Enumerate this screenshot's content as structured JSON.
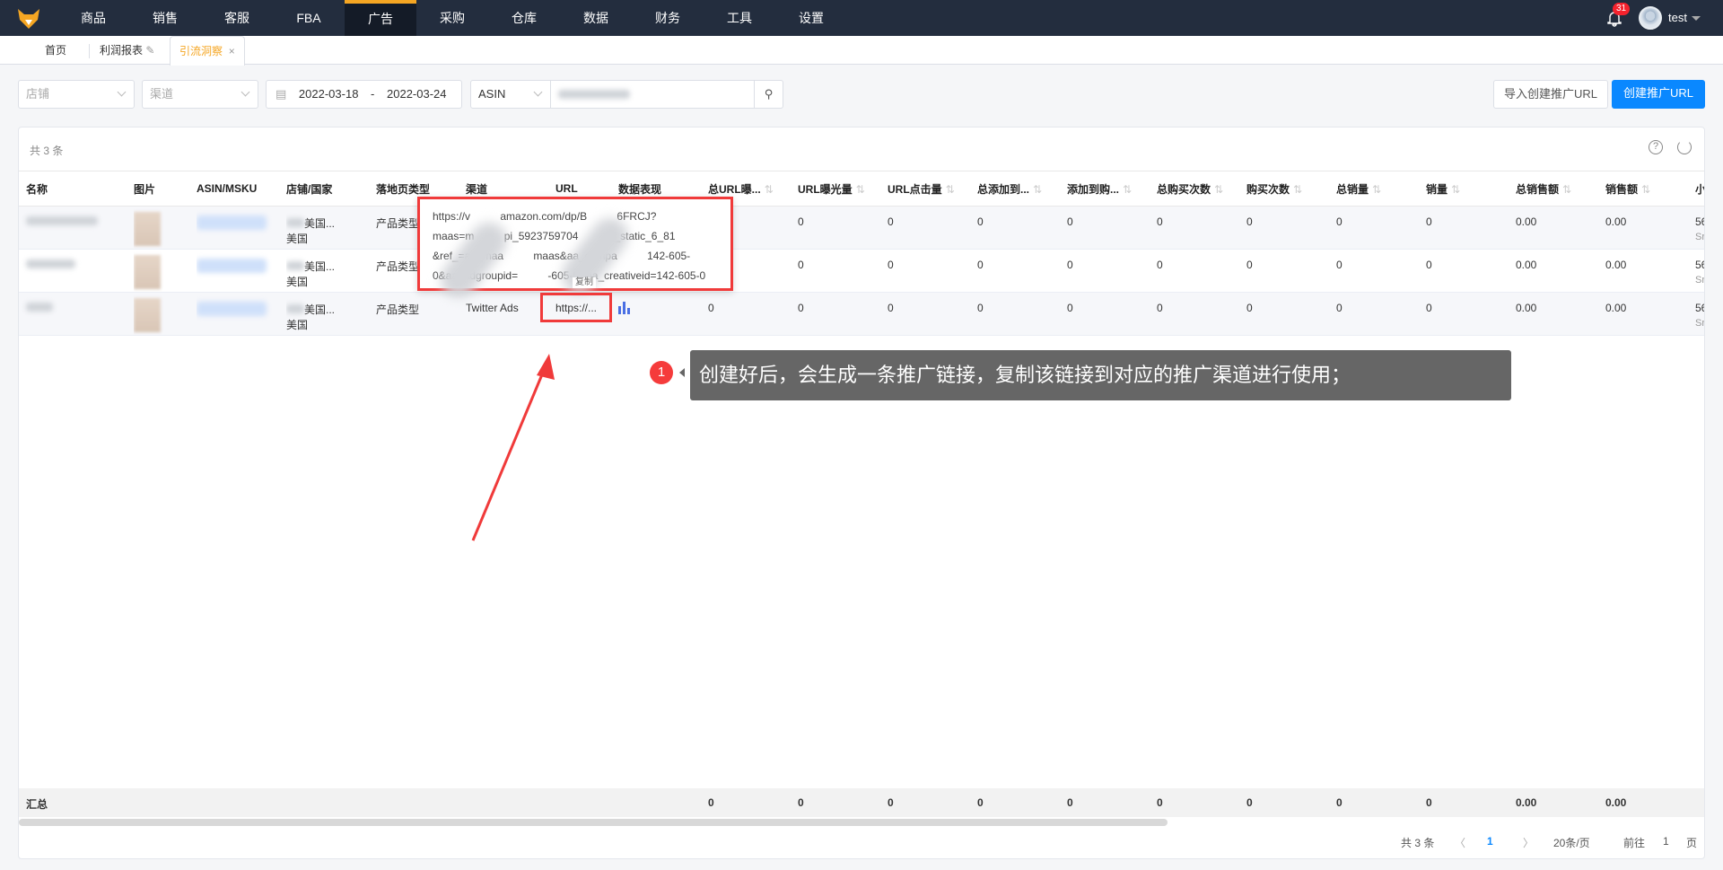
{
  "nav": {
    "items": [
      "商品",
      "销售",
      "客服",
      "FBA",
      "广告",
      "采购",
      "仓库",
      "数据",
      "财务",
      "工具",
      "设置"
    ],
    "active": "广告",
    "notifications": "31",
    "user": "test"
  },
  "tabs": {
    "home": "首页",
    "profit": "利润报表",
    "current": "引流洞察",
    "close": "×"
  },
  "filters": {
    "store_placeholder": "店铺",
    "channel_placeholder": "渠道",
    "date_start": "2022-03-18",
    "date_sep": "-",
    "date_end": "2022-03-24",
    "search_type": "ASIN"
  },
  "buttons": {
    "import": "导入创建推广URL",
    "create": "创建推广URL"
  },
  "table": {
    "total": "共 3 条",
    "columns": [
      "名称",
      "图片",
      "ASIN/MSKU",
      "店铺/国家",
      "落地页类型",
      "渠道",
      "URL",
      "数据表现",
      "总URL曝...",
      "URL曝光量",
      "URL点击量",
      "总添加到...",
      "添加到购...",
      "总购买次数",
      "购买次数",
      "总销量",
      "销量",
      "总销售额",
      "销售额",
      "小"
    ],
    "rows": [
      {
        "store": "美国...",
        "country": "美国",
        "landing": "产品类型",
        "channel": "",
        "url": "",
        "metrics": [
          "0",
          "0",
          "0",
          "0",
          "0",
          "0",
          "0",
          "0",
          "0",
          "0.00",
          "0.00"
        ],
        "last": "56",
        "last_sub": "Sr"
      },
      {
        "store": "美国...",
        "country": "美国",
        "landing": "产品类型",
        "channel": "",
        "url": "",
        "metrics": [
          "0",
          "0",
          "0",
          "0",
          "0",
          "0",
          "0",
          "0",
          "0",
          "0.00",
          "0.00"
        ],
        "last": "56",
        "last_sub": "Sr"
      },
      {
        "store": "美国...",
        "country": "美国",
        "landing": "产品类型",
        "channel": "Twitter Ads",
        "url": "https://...",
        "metrics": [
          "0",
          "0",
          "0",
          "0",
          "0",
          "0",
          "0",
          "0",
          "0",
          "0.00",
          "0.00"
        ],
        "last": "56",
        "last_sub": "Sr"
      }
    ],
    "summary": {
      "label": "汇总",
      "values": [
        "0",
        "0",
        "0",
        "0",
        "0",
        "0",
        "0",
        "0",
        "0",
        "0.00",
        "0.00"
      ]
    }
  },
  "pagination": {
    "total": "共 3 条",
    "prev": "〈",
    "page": "1",
    "next": "〉",
    "page_size": "20条/页",
    "goto": "前往",
    "goto_value": "1",
    "page_unit": "页"
  },
  "popover": {
    "lines": [
      "https://v          amazon.com/dp/B          6FRCJ?",
      "maas=m          pi_5923759704          6_static_6_81",
      "&ref_=aa_maa          maas&aa_campa          142-605-",
      "0&aa_adgroupid=          -605-0&aa_creativeid=142-605-0"
    ],
    "copy": "复制"
  },
  "annotation": {
    "step": "1",
    "text": "创建好后，会生成一条推广链接，复制该链接到对应的推广渠道进行使用；"
  },
  "colors": {
    "nav_bg": "#232d3e",
    "accent": "#f5a623",
    "primary": "#0a88ff",
    "highlight": "#f03a3a"
  }
}
